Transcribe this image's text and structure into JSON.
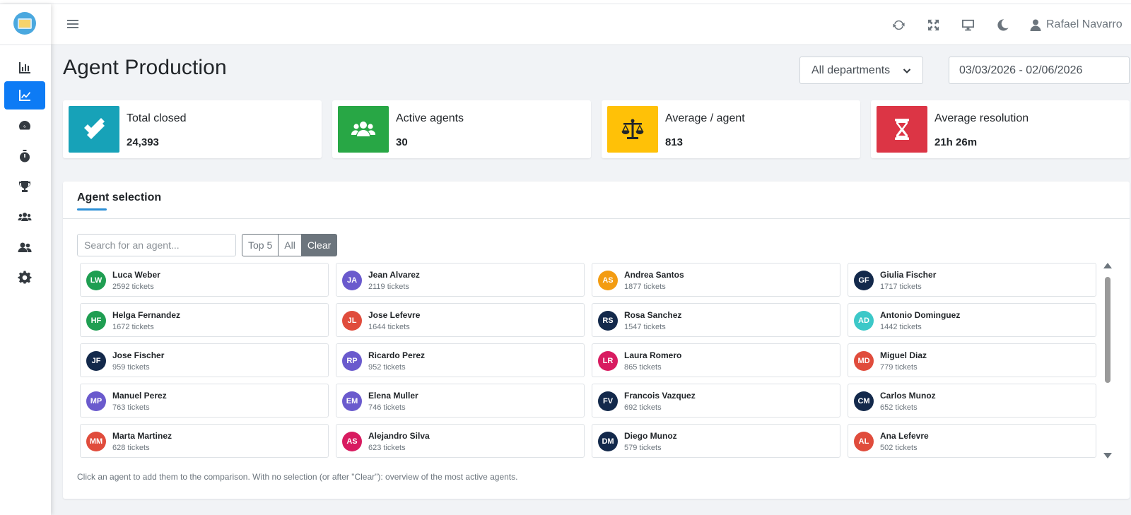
{
  "colors": {
    "accent": "#0d7bf5",
    "kpi_closed": "#17a2b8",
    "kpi_active": "#28a745",
    "kpi_average": "#ffc107",
    "kpi_resolution": "#dc3545"
  },
  "sidebar": {
    "items": [
      {
        "icon": "bar-chart-icon",
        "active": false
      },
      {
        "icon": "line-chart-icon",
        "active": true
      },
      {
        "icon": "speedometer-icon",
        "active": false
      },
      {
        "icon": "stopwatch-icon",
        "active": false
      },
      {
        "icon": "trophy-icon",
        "active": false
      },
      {
        "icon": "users-group-icon",
        "active": false
      },
      {
        "icon": "user-friends-icon",
        "active": false
      },
      {
        "icon": "gear-icon",
        "active": false
      }
    ]
  },
  "topbar": {
    "icons": [
      "refresh-icon",
      "expand-icon",
      "monitor-icon",
      "moon-icon"
    ],
    "user_name": "Rafael Navarro"
  },
  "header": {
    "title": "Agent Production",
    "department_select": "All departments",
    "date_range": "03/03/2026 - 02/06/2026"
  },
  "kpis": [
    {
      "label": "Total closed",
      "value": "24,393",
      "icon": "double-check-icon",
      "color": "#17a2b8"
    },
    {
      "label": "Active agents",
      "value": "30",
      "icon": "users-icon",
      "color": "#28a745"
    },
    {
      "label": "Average / agent",
      "value": "813",
      "icon": "balance-scale-icon",
      "color": "#ffc107"
    },
    {
      "label": "Average resolution",
      "value": "21h 26m",
      "icon": "hourglass-icon",
      "color": "#dc3545"
    }
  ],
  "selection": {
    "title": "Agent selection",
    "search_placeholder": "Search for an agent...",
    "buttons": {
      "top5": "Top 5",
      "all": "All",
      "clear": "Clear"
    },
    "help": "Click an agent to add them to the comparison. With no selection (or after \"Clear\"): overview of the most active agents.",
    "agents": [
      {
        "initials": "LW",
        "name": "Luca Weber",
        "count": "2592 tickets",
        "color": "#1f9e52"
      },
      {
        "initials": "JA",
        "name": "Jean Alvarez",
        "count": "2119 tickets",
        "color": "#6a5acd"
      },
      {
        "initials": "AS",
        "name": "Andrea Santos",
        "count": "1877 tickets",
        "color": "#f39c12"
      },
      {
        "initials": "GF",
        "name": "Giulia Fischer",
        "count": "1717 tickets",
        "color": "#13294b"
      },
      {
        "initials": "HF",
        "name": "Helga Fernandez",
        "count": "1672 tickets",
        "color": "#1f9e52"
      },
      {
        "initials": "JL",
        "name": "Jose Lefevre",
        "count": "1644 tickets",
        "color": "#e04c3c"
      },
      {
        "initials": "RS",
        "name": "Rosa Sanchez",
        "count": "1547 tickets",
        "color": "#13294b"
      },
      {
        "initials": "AD",
        "name": "Antonio Dominguez",
        "count": "1442 tickets",
        "color": "#3cc8c8"
      },
      {
        "initials": "JF",
        "name": "Jose Fischer",
        "count": "959 tickets",
        "color": "#13294b"
      },
      {
        "initials": "RP",
        "name": "Ricardo Perez",
        "count": "952 tickets",
        "color": "#6a5acd"
      },
      {
        "initials": "LR",
        "name": "Laura Romero",
        "count": "865 tickets",
        "color": "#d81b60"
      },
      {
        "initials": "MD",
        "name": "Miguel Diaz",
        "count": "779 tickets",
        "color": "#e04c3c"
      },
      {
        "initials": "MP",
        "name": "Manuel Perez",
        "count": "763 tickets",
        "color": "#6a5acd"
      },
      {
        "initials": "EM",
        "name": "Elena Muller",
        "count": "746 tickets",
        "color": "#6a5acd"
      },
      {
        "initials": "FV",
        "name": "Francois Vazquez",
        "count": "692 tickets",
        "color": "#13294b"
      },
      {
        "initials": "CM",
        "name": "Carlos Munoz",
        "count": "652 tickets",
        "color": "#13294b"
      },
      {
        "initials": "MM",
        "name": "Marta Martinez",
        "count": "628 tickets",
        "color": "#e04c3c"
      },
      {
        "initials": "AS",
        "name": "Alejandro Silva",
        "count": "623 tickets",
        "color": "#d81b60"
      },
      {
        "initials": "DM",
        "name": "Diego Munoz",
        "count": "579 tickets",
        "color": "#13294b"
      },
      {
        "initials": "AL",
        "name": "Ana Lefevre",
        "count": "502 tickets",
        "color": "#e04c3c"
      }
    ]
  }
}
